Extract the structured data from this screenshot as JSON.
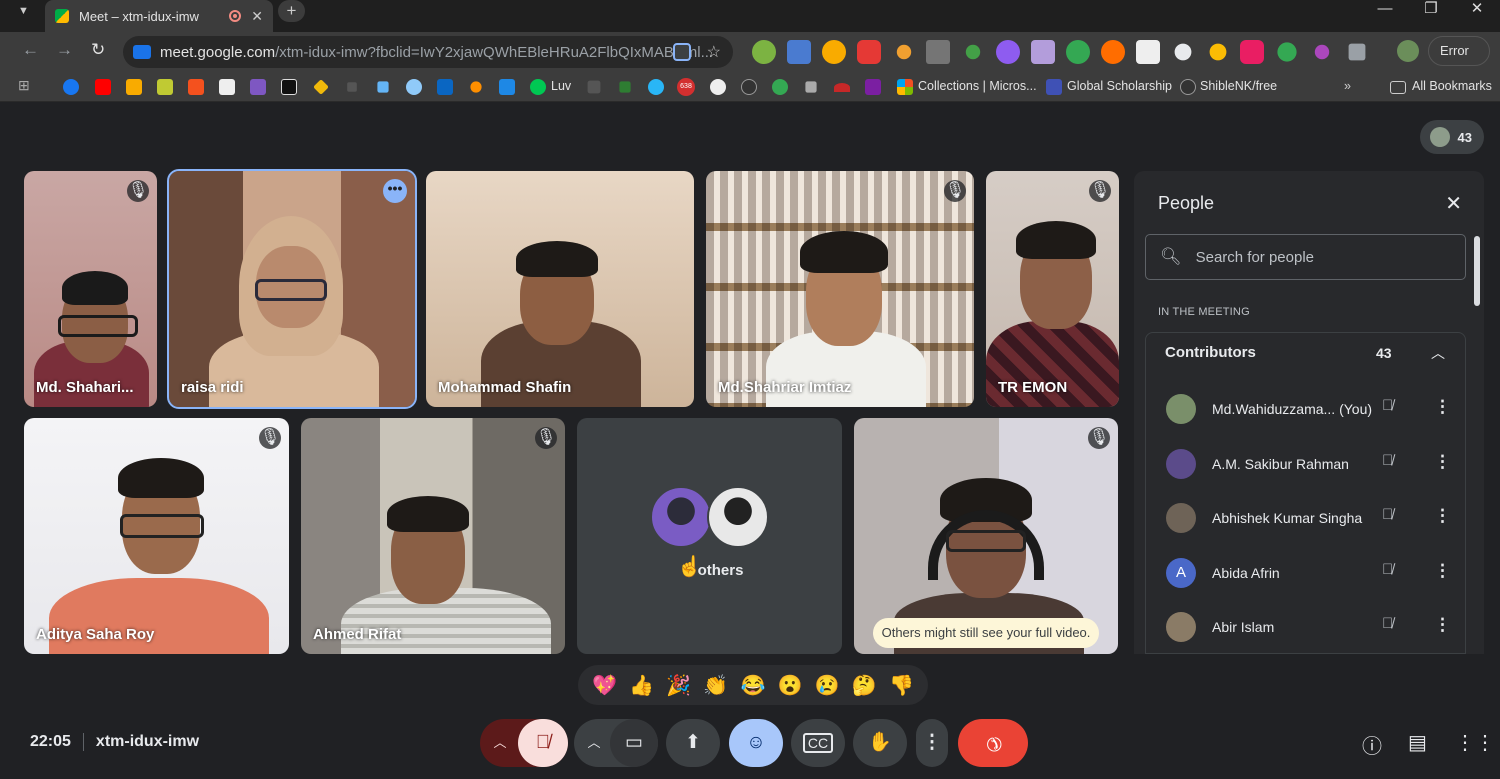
{
  "browser": {
    "tab_title": "Meet – xtm-idux-imw",
    "url_host": "meet.google.com",
    "url_rest": "/xtm-idux-imw?fbclid=IwY2xjawQWhEBleHRuA2FlbQIxMABicml...",
    "error_label": "Error",
    "bookmarks": [
      "Luv",
      "Collections | Micros...",
      "Global Scholarship",
      "ShibleNK/free"
    ],
    "all_bookmarks": "All Bookmarks",
    "bookmark_badge": "638"
  },
  "meeting": {
    "participant_count": "43",
    "time": "22:05",
    "code": "xtm-idux-imw",
    "tiles": [
      {
        "name": "Md. Shahari..."
      },
      {
        "name": "raisa ridi"
      },
      {
        "name": "Mohammad Shafin"
      },
      {
        "name": "Md.Shahriar Imtiaz"
      },
      {
        "name": "TR EMON"
      },
      {
        "name": "Aditya Saha Roy"
      },
      {
        "name": "Ahmed Rifat"
      },
      {
        "name": "others"
      },
      {
        "name": ""
      }
    ],
    "toast": "Others might still see your full video.",
    "reactions": [
      "💖",
      "👍",
      "🎉",
      "👏",
      "😂",
      "😮",
      "😢",
      "🤔",
      "👎"
    ]
  },
  "people_panel": {
    "title": "People",
    "search_placeholder": "Search for people",
    "section": "IN THE MEETING",
    "group_title": "Contributors",
    "group_count": "43",
    "people": [
      {
        "name": "Md.Wahiduzzama... (You)",
        "avatar": "",
        "color": "#7a8f6a"
      },
      {
        "name": "A.M. Sakibur Rahman",
        "avatar": "",
        "color": "#5b4b8a"
      },
      {
        "name": "Abhishek Kumar Singha",
        "avatar": "",
        "color": "#6e6357"
      },
      {
        "name": "Abida Afrin",
        "avatar": "A",
        "color": "#4a68c8"
      },
      {
        "name": "Abir Islam",
        "avatar": "",
        "color": "#8a7b66"
      }
    ]
  },
  "icons": {
    "mic_off": "mic-off-icon",
    "camera": "camera-icon",
    "present": "present-icon",
    "emoji": "emoji-icon",
    "captions": "captions-icon",
    "raise_hand": "raise-hand-icon",
    "hangup": "hangup-icon"
  },
  "colors": {
    "accent": "#8ab4f8",
    "hangup": "#ea4335",
    "emoji_active": "#a8c7fa",
    "mic_muted_bg": "#f9dedc"
  }
}
